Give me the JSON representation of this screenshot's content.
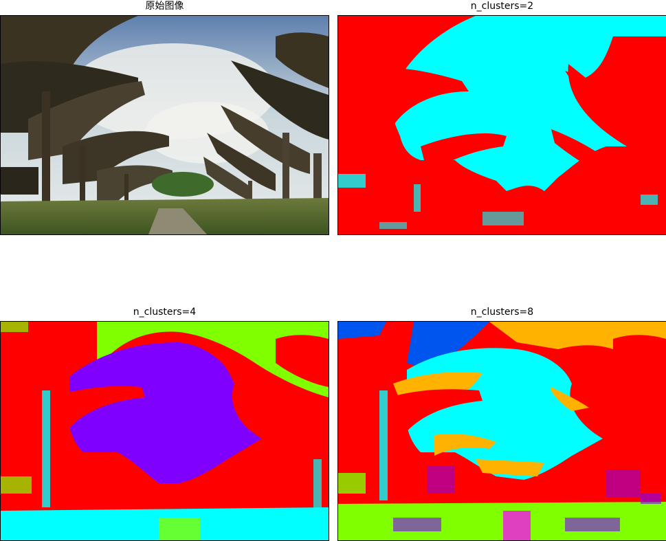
{
  "panels": [
    {
      "title": "原始图像",
      "kind": "original"
    },
    {
      "title": "n_clusters=2",
      "kind": "k2"
    },
    {
      "title": "n_clusters=4",
      "kind": "k4"
    },
    {
      "title": "n_clusters=8",
      "kind": "k8"
    }
  ],
  "palette": {
    "red": "#ff0000",
    "cyan": "#00ffff",
    "violet": "#7f00ff",
    "lime": "#80ff00",
    "blue": "#0055ee",
    "orange": "#ffb300",
    "magenta": "#ff00ff",
    "green": "#00ff40"
  }
}
